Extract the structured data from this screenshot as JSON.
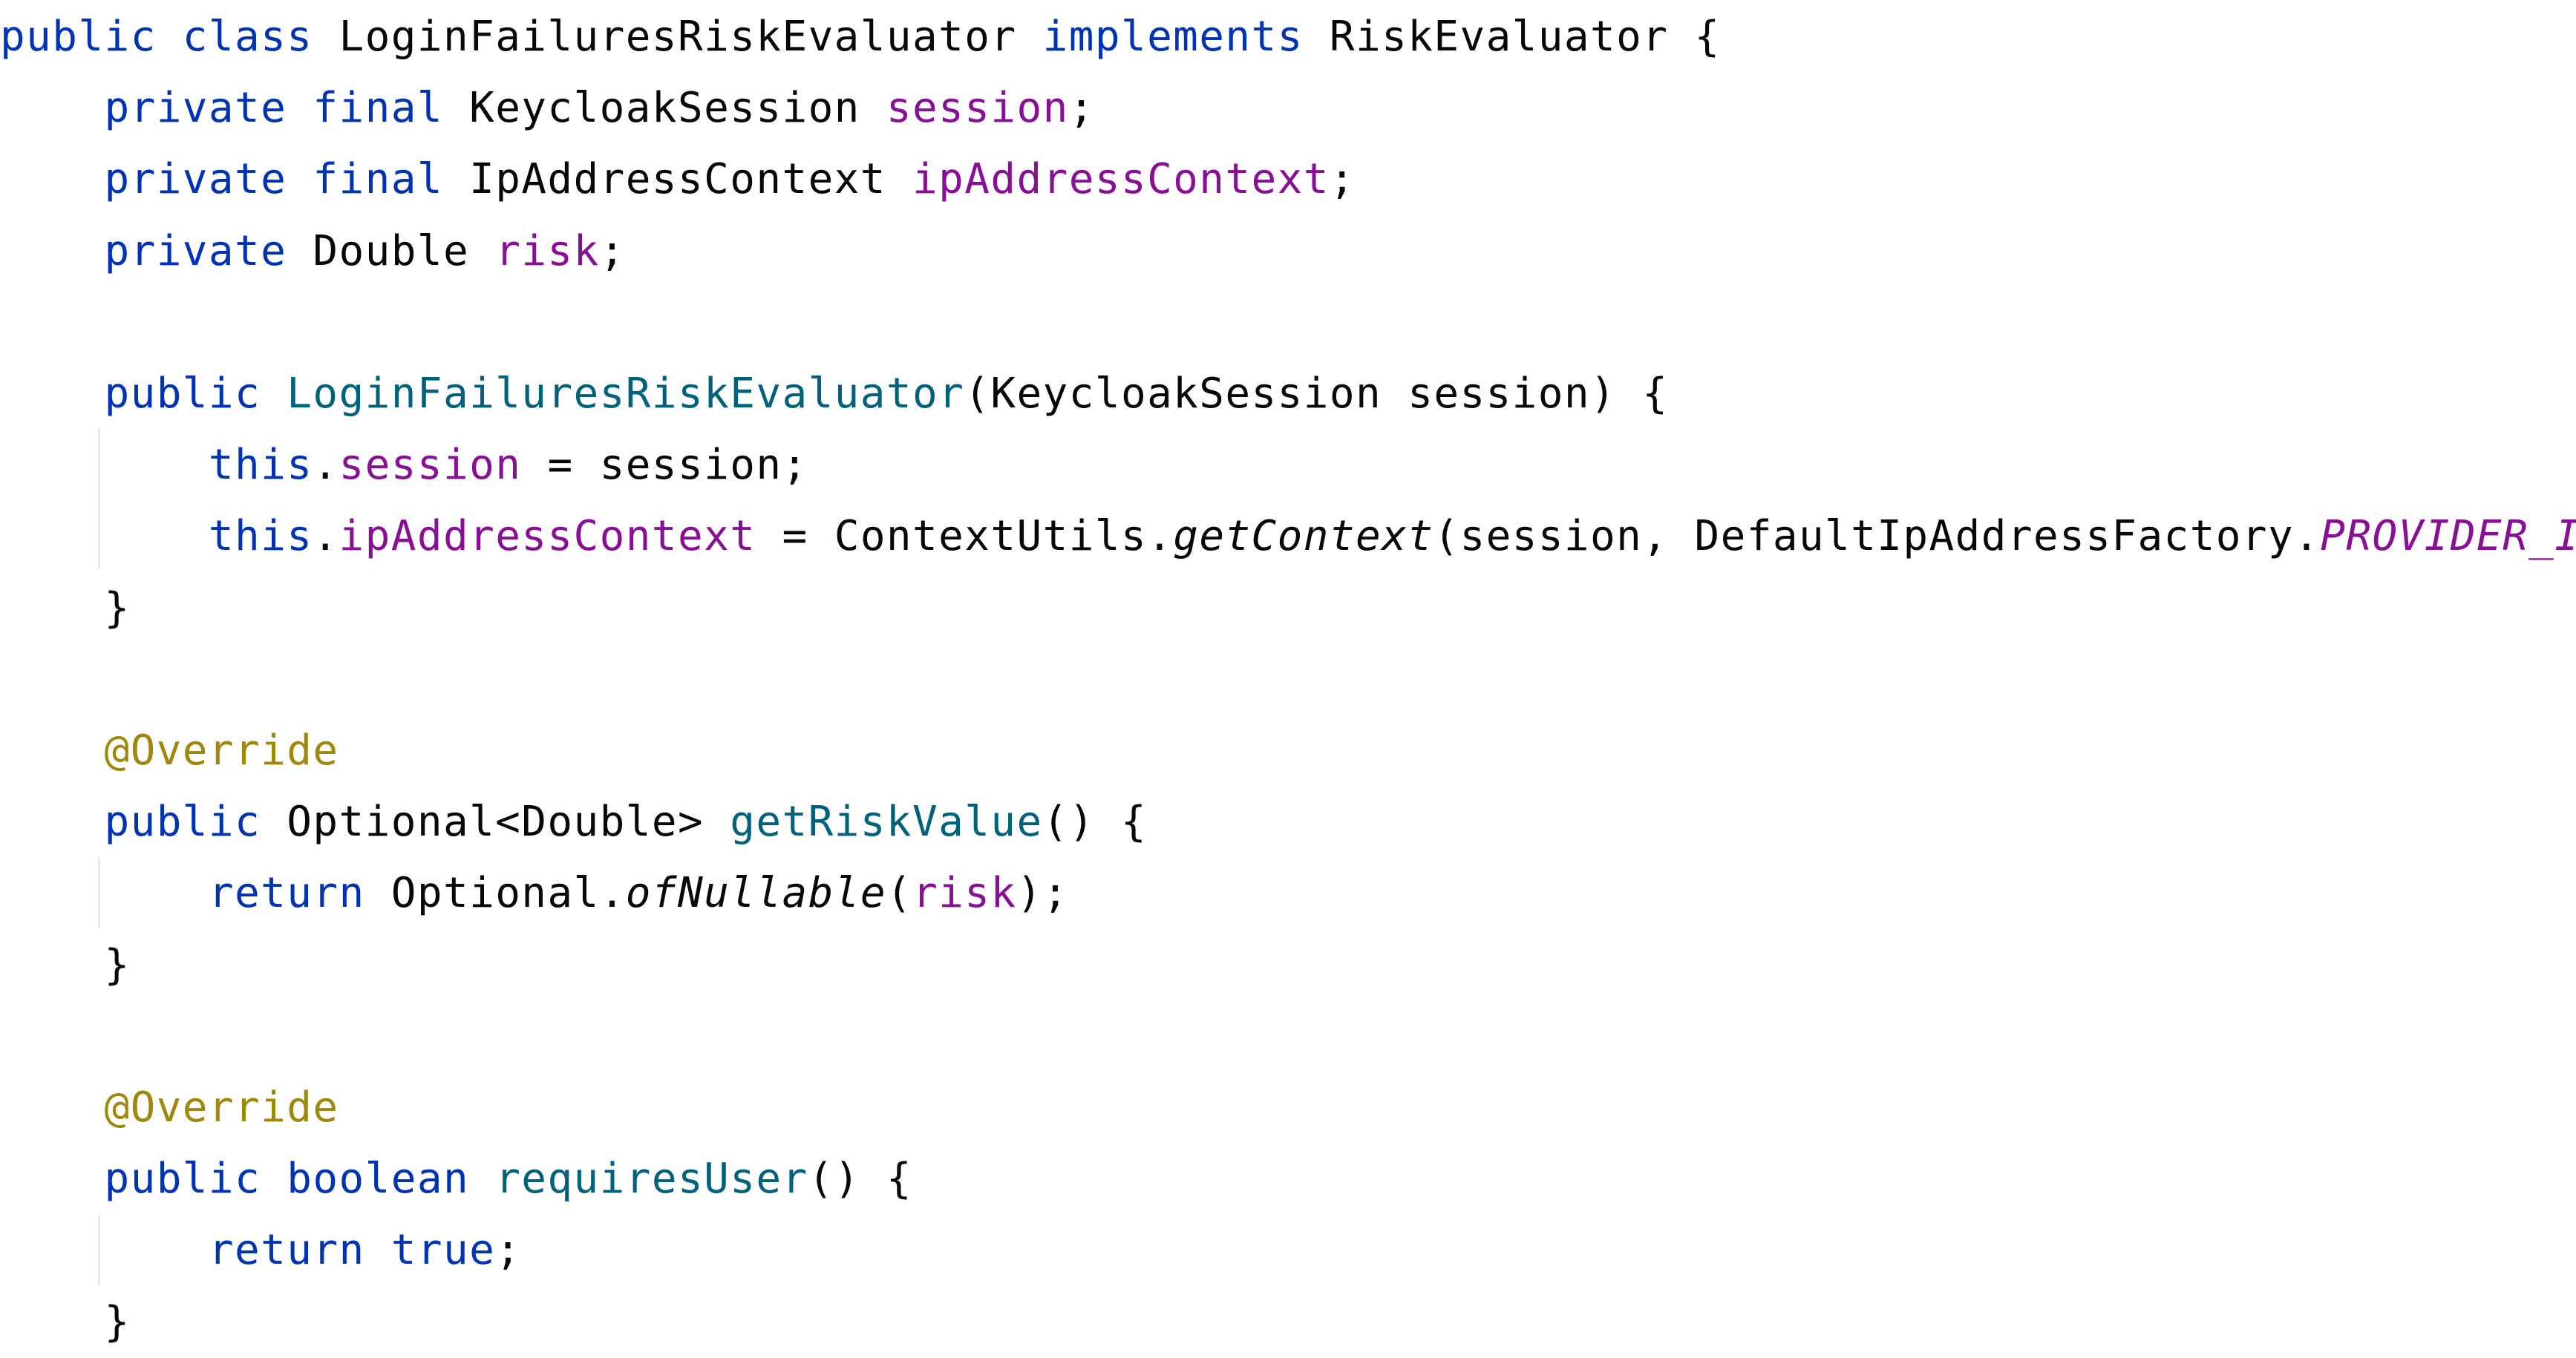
{
  "editor": {
    "language": "java",
    "colors": {
      "keyword": "#0033b3",
      "field": "#871094",
      "method_declaration": "#00627a",
      "annotation": "#9e880d",
      "default_text": "#080808",
      "background": "#ffffff"
    },
    "lines": [
      [
        {
          "text": "public class ",
          "style": "keyword"
        },
        {
          "text": "LoginFailuresRiskEvaluator ",
          "style": "plain"
        },
        {
          "text": "implements ",
          "style": "keyword"
        },
        {
          "text": "RiskEvaluator {",
          "style": "plain"
        }
      ],
      [
        {
          "text": "    private final ",
          "style": "keyword"
        },
        {
          "text": "KeycloakSession ",
          "style": "plain"
        },
        {
          "text": "session",
          "style": "field"
        },
        {
          "text": ";",
          "style": "plain"
        }
      ],
      [
        {
          "text": "    private final ",
          "style": "keyword"
        },
        {
          "text": "IpAddressContext ",
          "style": "plain"
        },
        {
          "text": "ipAddressContext",
          "style": "field"
        },
        {
          "text": ";",
          "style": "plain"
        }
      ],
      [
        {
          "text": "    private ",
          "style": "keyword"
        },
        {
          "text": "Double ",
          "style": "plain"
        },
        {
          "text": "risk",
          "style": "field"
        },
        {
          "text": ";",
          "style": "plain"
        }
      ],
      [],
      [
        {
          "text": "    public ",
          "style": "keyword"
        },
        {
          "text": "LoginFailuresRiskEvaluator",
          "style": "method_declaration"
        },
        {
          "text": "(KeycloakSession session) {",
          "style": "plain"
        }
      ],
      [
        {
          "text": "        this",
          "style": "keyword"
        },
        {
          "text": ".",
          "style": "plain"
        },
        {
          "text": "session",
          "style": "field"
        },
        {
          "text": " = session;",
          "style": "plain"
        }
      ],
      [
        {
          "text": "        this",
          "style": "keyword"
        },
        {
          "text": ".",
          "style": "plain"
        },
        {
          "text": "ipAddressContext",
          "style": "field"
        },
        {
          "text": " = ContextUtils.",
          "style": "plain"
        },
        {
          "text": "getContext",
          "style": "static_call"
        },
        {
          "text": "(session, DefaultIpAddressFactory.",
          "style": "plain"
        },
        {
          "text": "PROVIDER_ID",
          "style": "static_field"
        },
        {
          "text": ");",
          "style": "plain"
        }
      ],
      [
        {
          "text": "    }",
          "style": "plain"
        }
      ],
      [],
      [
        {
          "text": "    @Override",
          "style": "annotation"
        }
      ],
      [
        {
          "text": "    public ",
          "style": "keyword"
        },
        {
          "text": "Optional<Double> ",
          "style": "plain"
        },
        {
          "text": "getRiskValue",
          "style": "method_declaration"
        },
        {
          "text": "() {",
          "style": "plain"
        }
      ],
      [
        {
          "text": "        return ",
          "style": "keyword"
        },
        {
          "text": "Optional.",
          "style": "plain"
        },
        {
          "text": "ofNullable",
          "style": "static_call"
        },
        {
          "text": "(",
          "style": "plain"
        },
        {
          "text": "risk",
          "style": "field"
        },
        {
          "text": ");",
          "style": "plain"
        }
      ],
      [
        {
          "text": "    }",
          "style": "plain"
        }
      ],
      [],
      [
        {
          "text": "    @Override",
          "style": "annotation"
        }
      ],
      [
        {
          "text": "    public boolean ",
          "style": "keyword"
        },
        {
          "text": "requiresUser",
          "style": "method_declaration"
        },
        {
          "text": "() {",
          "style": "plain"
        }
      ],
      [
        {
          "text": "        return true",
          "style": "keyword"
        },
        {
          "text": ";",
          "style": "plain"
        }
      ],
      [
        {
          "text": "    }",
          "style": "plain"
        }
      ]
    ]
  }
}
